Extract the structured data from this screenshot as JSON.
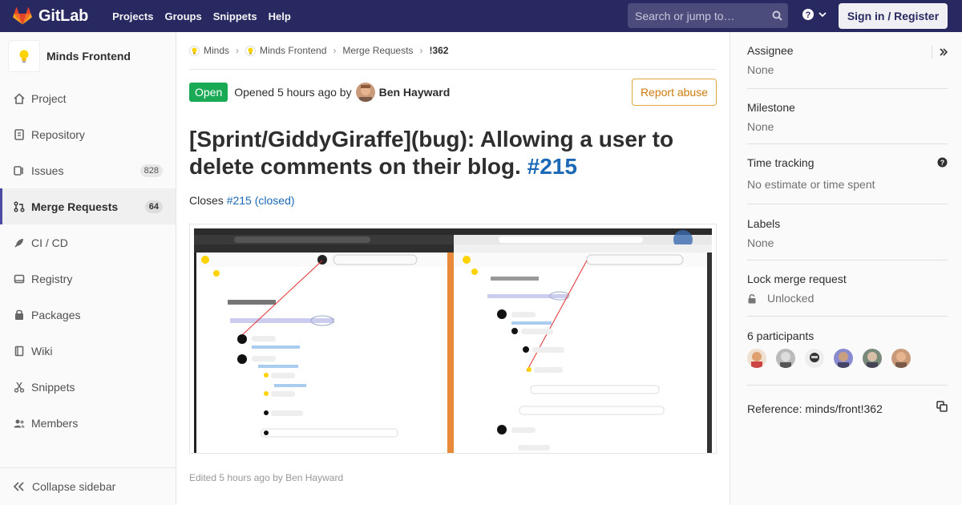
{
  "nav": {
    "brand": "GitLab",
    "links": [
      "Projects",
      "Groups",
      "Snippets",
      "Help"
    ],
    "search_placeholder": "Search or jump to…",
    "sign_in": "Sign in / Register"
  },
  "sidebar": {
    "project_name": "Minds Frontend",
    "items": [
      {
        "label": "Project",
        "icon": "home-icon"
      },
      {
        "label": "Repository",
        "icon": "doc-icon"
      },
      {
        "label": "Issues",
        "icon": "issues-icon",
        "count": "828"
      },
      {
        "label": "Merge Requests",
        "icon": "merge-request-icon",
        "count": "64",
        "active": true
      },
      {
        "label": "CI / CD",
        "icon": "rocket-icon"
      },
      {
        "label": "Registry",
        "icon": "container-icon"
      },
      {
        "label": "Packages",
        "icon": "package-icon"
      },
      {
        "label": "Wiki",
        "icon": "book-icon"
      },
      {
        "label": "Snippets",
        "icon": "scissors-icon"
      },
      {
        "label": "Members",
        "icon": "users-icon"
      }
    ],
    "collapse": "Collapse sidebar"
  },
  "breadcrumb": {
    "items": [
      "Minds",
      "Minds Frontend",
      "Merge Requests",
      "!362"
    ]
  },
  "mr": {
    "status": "Open",
    "opened_text": "Opened 5 hours ago by",
    "author": "Ben Hayward",
    "report": "Report abuse",
    "title": "[Sprint/GiddyGiraffe](bug): Allowing a user to delete comments on their blog.",
    "title_ref": "#215",
    "closes_label": "Closes",
    "closes_ref": "#215 (closed)",
    "edited": "Edited 5 hours ago by Ben Hayward"
  },
  "right": {
    "assignee_title": "Assignee",
    "assignee_value": "None",
    "milestone_title": "Milestone",
    "milestone_value": "None",
    "time_title": "Time tracking",
    "time_value": "No estimate or time spent",
    "labels_title": "Labels",
    "labels_value": "None",
    "lock_title": "Lock merge request",
    "lock_value": "Unlocked",
    "participants_title": "6 participants",
    "reference": "Reference: minds/front!362"
  },
  "colors": {
    "nav_bg": "#292961",
    "open_green": "#1aaa55",
    "link_blue": "#1b69b6",
    "report_orange": "#d07b0c"
  }
}
